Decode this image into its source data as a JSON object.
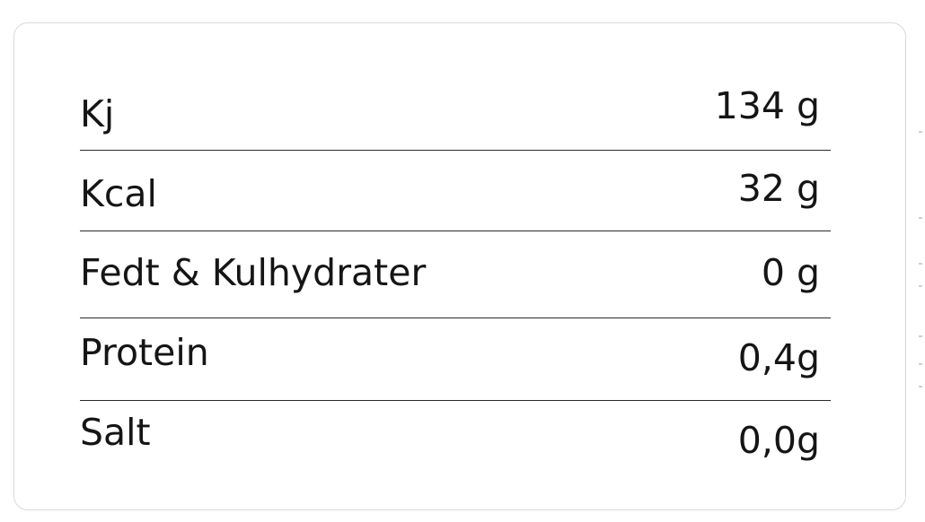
{
  "nutrition_table": {
    "rows": [
      {
        "label": "Kj",
        "value": "134 g"
      },
      {
        "label": "Kcal",
        "value": "32 g"
      },
      {
        "label": "Fedt & Kulhydrater",
        "value": "0 g"
      },
      {
        "label": "Protein",
        "value": "0,4g"
      },
      {
        "label": "Salt",
        "value": "0,0g"
      }
    ]
  }
}
